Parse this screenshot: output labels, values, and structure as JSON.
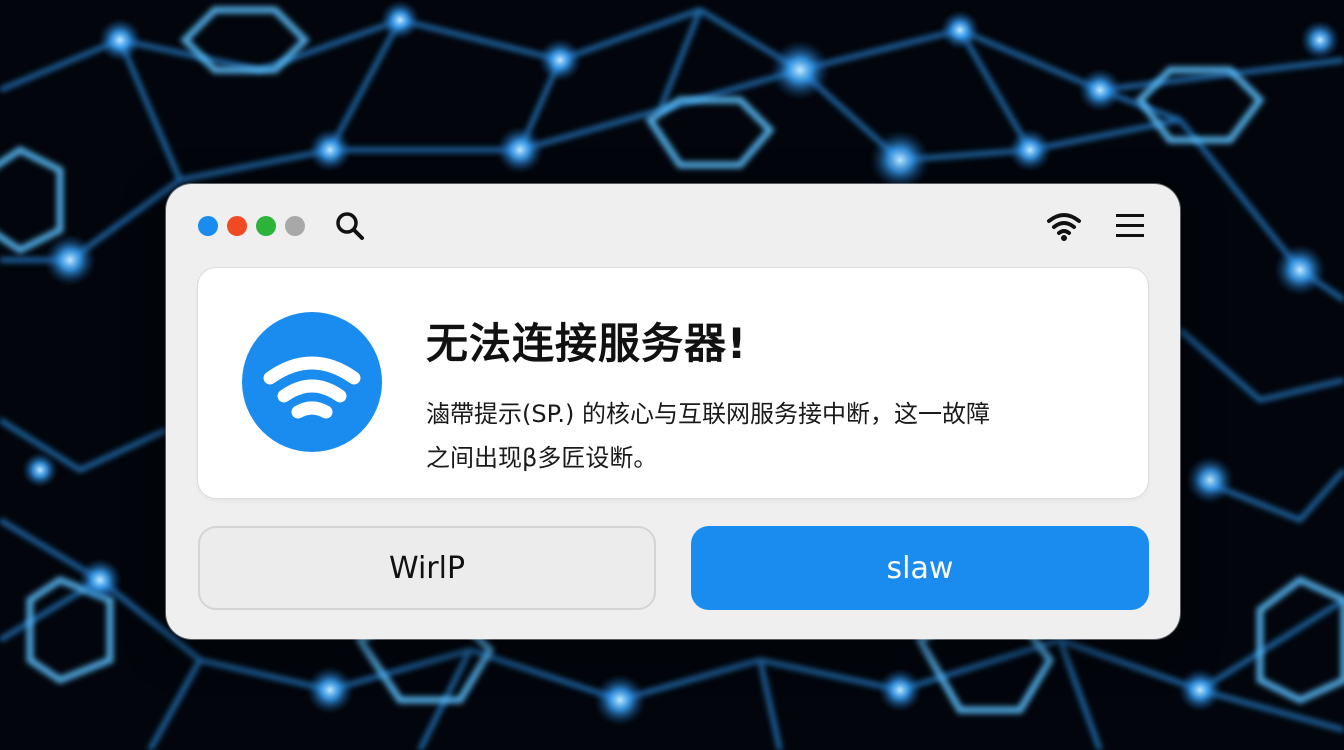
{
  "window": {
    "titlebar_dots": [
      {
        "name": "blue",
        "color": "#1a8cf0"
      },
      {
        "name": "red",
        "color": "#f04a23"
      },
      {
        "name": "green",
        "color": "#2db23a"
      },
      {
        "name": "gray",
        "color": "#a8a8a8"
      }
    ],
    "icons": {
      "search": "search-icon",
      "wifi": "wifi-icon",
      "menu": "hamburger-menu-icon"
    }
  },
  "dialog": {
    "icon": "wifi-icon",
    "title": "无法连接服务器!",
    "message_line1": "滷帶提示(SP.) 的核心与互联网服务接中断，这一故障",
    "message_line2": "之间出现β多匠设断。"
  },
  "buttons": {
    "secondary_label": "WirlP",
    "primary_label": "slaw"
  },
  "colors": {
    "accent": "#1a8cf0",
    "window_bg": "#efefef",
    "card_bg": "#ffffff"
  }
}
